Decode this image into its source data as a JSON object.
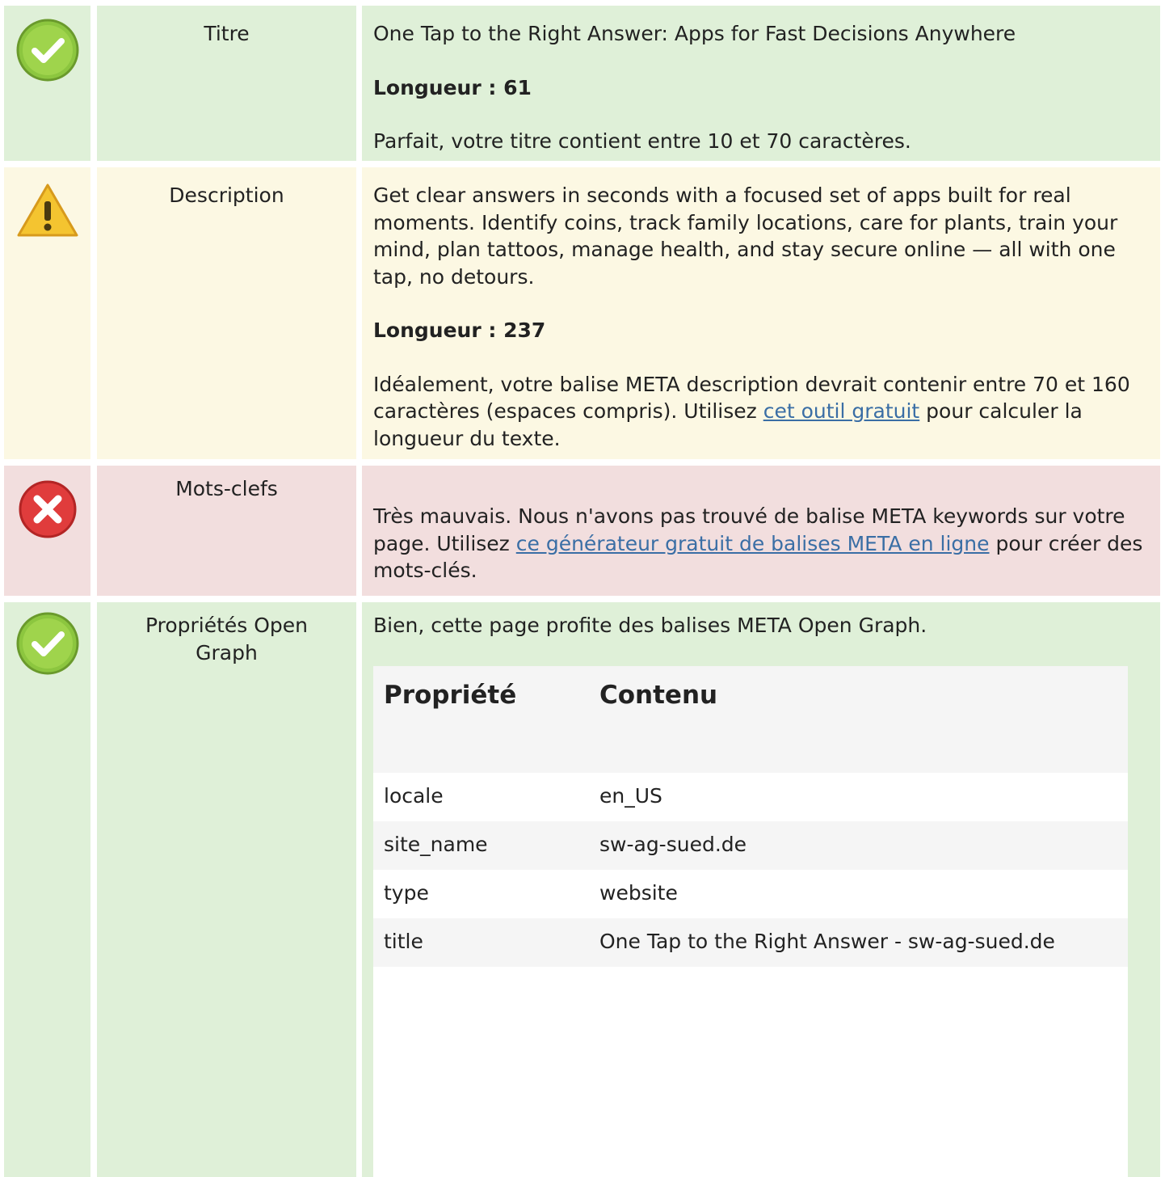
{
  "rows": {
    "title": {
      "status": "good",
      "label": "Titre",
      "value": "One Tap to the Right Answer: Apps for Fast Decisions Anywhere",
      "length": "Longueur : 61",
      "message": "Parfait, votre titre contient entre 10 et 70 caractères."
    },
    "description": {
      "status": "warning",
      "label": "Description",
      "value": "Get clear answers in seconds with a focused set of apps built for real moments. Identify coins, track family locations, care for plants, train your mind, plan tattoos, manage health, and stay secure online — all with one tap, no detours.",
      "length": "Longueur : 237",
      "message_before": "Idéalement, votre balise META description devrait contenir entre 70 et 160 caractères (espaces compris). Utilisez ",
      "link": "cet outil gratuit",
      "message_after": " pour calculer la longueur du texte."
    },
    "keywords": {
      "status": "bad",
      "label": "Mots-clefs",
      "message_before": "Très mauvais. Nous n'avons pas trouvé de balise META keywords sur votre page. Utilisez ",
      "link": "ce générateur gratuit de balises META en ligne",
      "message_after": " pour créer des mots-clés."
    },
    "opengraph": {
      "status": "good",
      "label": "Propriétés Open Graph",
      "message": "Bien, cette page profite des balises META Open Graph.",
      "table": {
        "headers": [
          "Propriété",
          "Contenu"
        ],
        "rows": [
          {
            "property": "locale",
            "content": "en_US"
          },
          {
            "property": "site_name",
            "content": "sw-ag-sued.de"
          },
          {
            "property": "type",
            "content": "website"
          },
          {
            "property": "title",
            "content": "One Tap to the Right Answer - sw-ag-sued.de"
          }
        ]
      }
    }
  },
  "icons": {
    "good": "check-circle-icon",
    "warning": "warning-triangle-icon",
    "bad": "error-circle-icon"
  },
  "colors": {
    "good_bg": "#dff0d8",
    "warning_bg": "#fcf8e3",
    "bad_bg": "#f2dede",
    "link": "#3a6ea5",
    "check_green": "#8cc63f",
    "warning_yellow": "#f4c430",
    "error_red": "#e03c3c"
  }
}
